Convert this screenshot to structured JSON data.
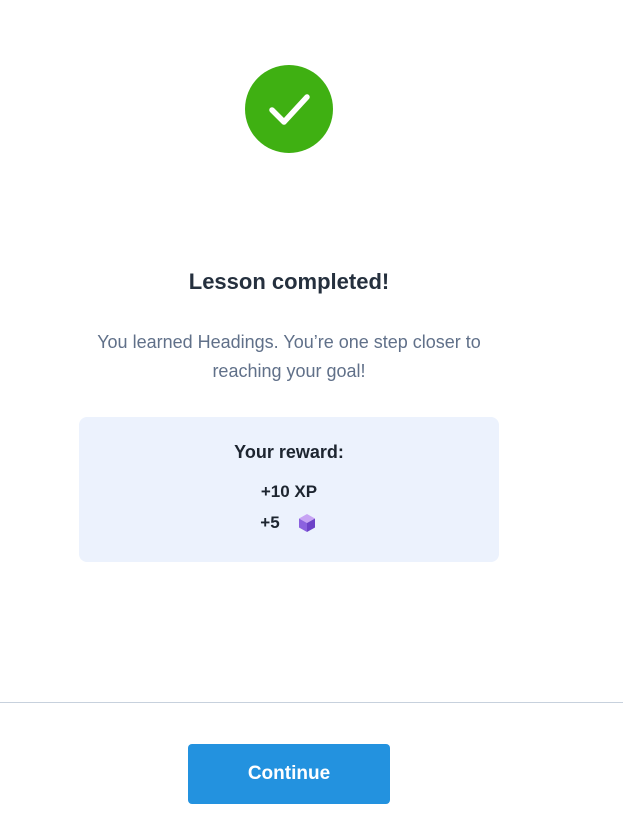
{
  "completion": {
    "icon": "checkmark-icon",
    "title": "Lesson completed!",
    "message": "You learned Headings. You’re one step closer to reaching your goal!"
  },
  "reward": {
    "title": "Your reward:",
    "xp": "+10 XP",
    "gems": "+5",
    "gem_icon": "gem-icon"
  },
  "actions": {
    "continue_label": "Continue"
  },
  "colors": {
    "success": "#3fb012",
    "primary": "#2392df",
    "reward_bg": "#ecf2fd"
  }
}
